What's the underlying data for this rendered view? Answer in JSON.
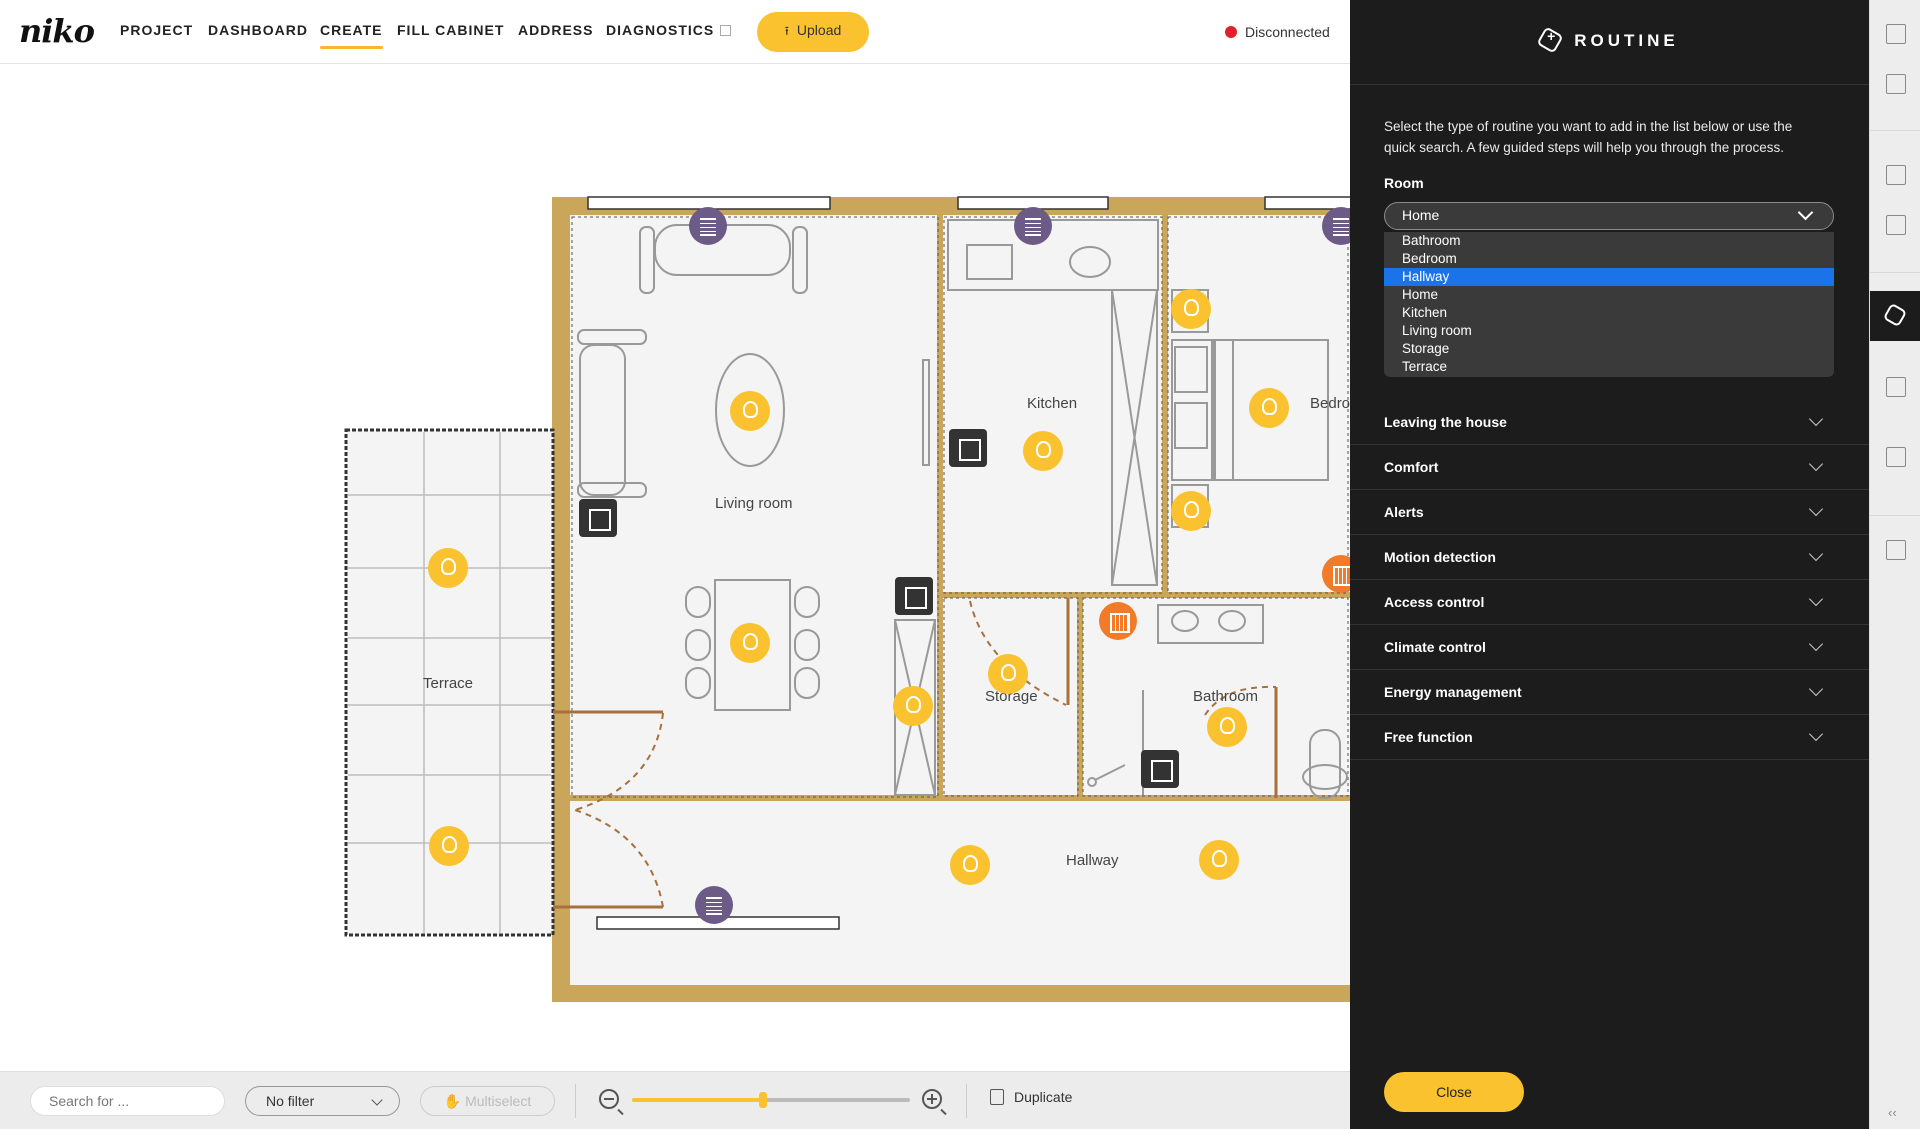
{
  "app": {
    "logo": "niko",
    "nav": [
      {
        "label": "PROJECT"
      },
      {
        "label": "DASHBOARD"
      },
      {
        "label": "CREATE"
      },
      {
        "label": "FILL CABINET"
      },
      {
        "label": "ADDRESS"
      },
      {
        "label": "DIAGNOSTICS"
      }
    ],
    "active_nav": "CREATE",
    "upload_label": "Upload",
    "status_text": "Disconnected"
  },
  "floorplan": {
    "rooms": [
      {
        "label": "Living room"
      },
      {
        "label": "Kitchen"
      },
      {
        "label": "Bedro"
      },
      {
        "label": "Terrace"
      },
      {
        "label": "Storage"
      },
      {
        "label": "Bathroom"
      },
      {
        "label": "Hallway"
      }
    ]
  },
  "bottombar": {
    "search_placeholder": "Search for ...",
    "filter_value": "No filter",
    "multiselect_label": "Multiselect",
    "zoom_level": 0.47,
    "duplicate_label": "Duplicate"
  },
  "panel": {
    "title": "ROUTINE",
    "description": "Select the type of routine you want to add in the list below or use the quick search. A few guided steps will help you through the process.",
    "room_label": "Room",
    "room_value": "Home",
    "room_options": [
      "Bathroom",
      "Bedroom",
      "Hallway",
      "Home",
      "Kitchen",
      "Living room",
      "Storage",
      "Terrace"
    ],
    "highlighted_option": "Hallway",
    "categories": [
      {
        "label": "Leaving the house"
      },
      {
        "label": "Comfort"
      },
      {
        "label": "Alerts"
      },
      {
        "label": "Motion detection"
      },
      {
        "label": "Access control"
      },
      {
        "label": "Climate control"
      },
      {
        "label": "Energy management"
      },
      {
        "label": "Free function"
      }
    ],
    "close_label": "Close"
  },
  "colors": {
    "accent": "#f9c22e",
    "panel_bg": "#1c1c1c",
    "wall": "#c9a65a",
    "status_red": "#e0202a",
    "highlight_blue": "#1a73e8"
  }
}
